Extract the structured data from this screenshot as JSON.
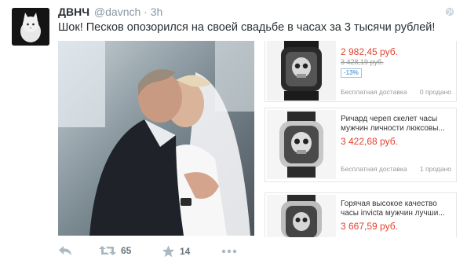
{
  "author": {
    "name": "ДВНЧ",
    "handle": "@davnch",
    "separator": "·",
    "time": "3h"
  },
  "tweet": {
    "text": "Шок! Песков опозорился на своей свадьбе в часах за 3 тысячи рублей!"
  },
  "products": [
    {
      "price": "2 982,45 руб.",
      "old_price": "3 428,19 руб.",
      "discount": "-13%",
      "shipping": "Бесплатная доставка",
      "sold": "0 продано"
    },
    {
      "title": "Ричард череп скелет часы мужчин личности люксовы...",
      "price": "3 422,68 руб.",
      "shipping": "Бесплатная доставка",
      "sold": "1 продано"
    },
    {
      "title": "Горячая высокое качество часы invicta мужчин лучши...",
      "price": "3 667,59 руб."
    }
  ],
  "actions": {
    "retweet_count": "65",
    "favorite_count": "14"
  },
  "icons": {
    "reply": "reply-icon",
    "retweet": "retweet-icon",
    "favorite": "star-icon",
    "more": "more-dots-icon",
    "globe": "globe-icon"
  },
  "colors": {
    "price_red": "#e0432f",
    "muted": "#8899a6",
    "action_gray": "#aab8c2"
  }
}
